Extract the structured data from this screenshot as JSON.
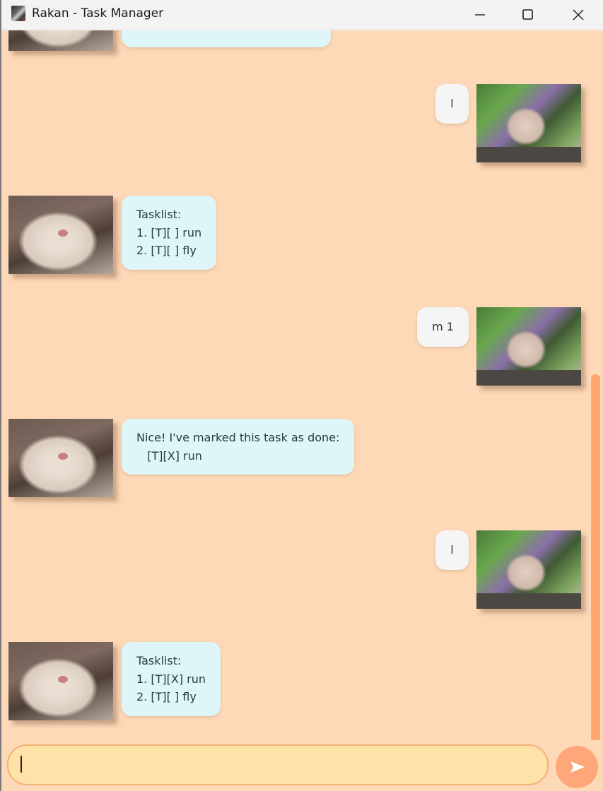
{
  "window": {
    "title": "Rakan - Task Manager"
  },
  "messages": [
    {
      "from": "bot",
      "lines": []
    },
    {
      "from": "user",
      "text": "l"
    },
    {
      "from": "bot",
      "lines": [
        "Tasklist:",
        "1. [T][ ] run",
        "2. [T][ ] fly"
      ]
    },
    {
      "from": "user",
      "text": "m 1"
    },
    {
      "from": "bot",
      "lines": [
        "Nice! I've marked this task as done:",
        "   [T][X] run"
      ]
    },
    {
      "from": "user",
      "text": "l"
    },
    {
      "from": "bot",
      "lines": [
        "Tasklist:",
        "1. [T][X] run",
        "2. [T][ ] fly"
      ]
    }
  ],
  "input": {
    "value": "",
    "placeholder": ""
  },
  "icons": {
    "send": "send-arrow-icon",
    "minimize": "minimize-icon",
    "maximize": "maximize-icon",
    "close": "close-icon"
  },
  "colors": {
    "background": "#fed9b7",
    "bot_bubble": "#dff6f8",
    "user_bubble": "#f5f5f5",
    "input": "#ffe2a8",
    "send_button": "#ffa77a",
    "scrollbar": "#ffa76f"
  }
}
